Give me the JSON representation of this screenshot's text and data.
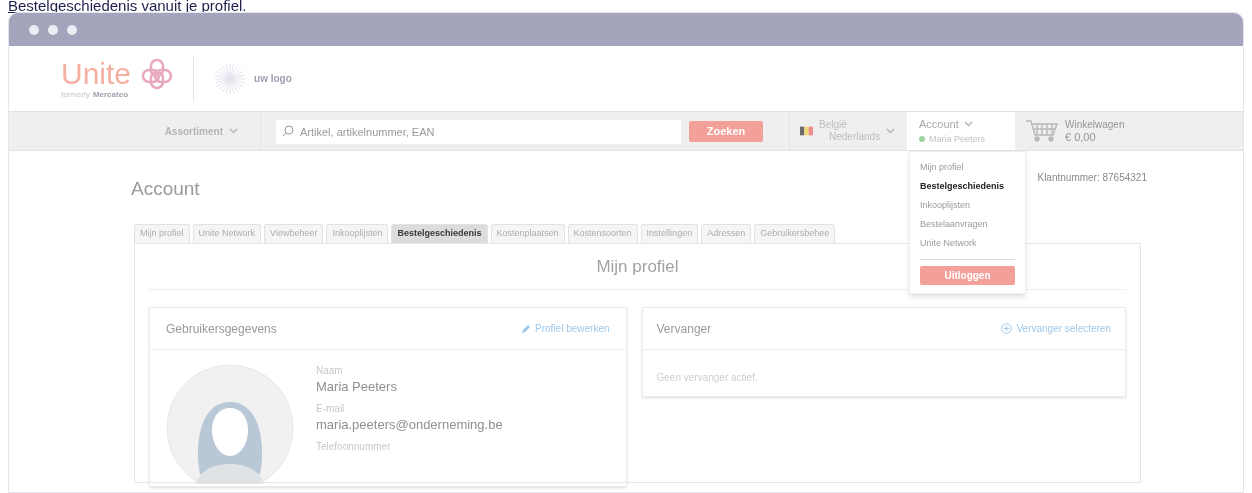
{
  "caption": {
    "link": "Bestelgeschiedenis",
    "text": "vanuit je profiel."
  },
  "header": {
    "brand": "Unite",
    "brand_sub_prefix": "formerly",
    "brand_sub_name": "Mercateo",
    "partner_logo": "uw logo"
  },
  "navbar": {
    "assortment": "Assortiment",
    "search": {
      "placeholder": "Artikel, artikelnummer, EAN"
    },
    "search_button": "Zoeken",
    "region": {
      "country": "België",
      "language": "Nederlands"
    },
    "account": {
      "label": "Account",
      "user": "Maria Peeters",
      "online": true
    },
    "cart": {
      "label": "Winkelwagen",
      "total": "€ 0,00"
    }
  },
  "account_menu": {
    "items": [
      {
        "label": "Mijn profiel",
        "selected": false
      },
      {
        "label": "Bestelgeschiedenis",
        "selected": true
      },
      {
        "label": "Inkooplijsten",
        "selected": false
      },
      {
        "label": "Bestelaanvragen",
        "selected": false
      },
      {
        "label": "Unite Network",
        "selected": false
      }
    ],
    "logout": "Uitloggen"
  },
  "page": {
    "title": "Account",
    "customer_number": "Klantnummer: 87654321"
  },
  "tabs": [
    {
      "label": "Mijn profiel",
      "selected": false
    },
    {
      "label": "Unite Network",
      "selected": false
    },
    {
      "label": "Viewbeheer",
      "selected": false
    },
    {
      "label": "Inkooplijsten",
      "selected": false
    },
    {
      "label": "Bestelgeschiedenis",
      "selected": true
    },
    {
      "label": "Kostenplaatsen",
      "selected": false
    },
    {
      "label": "Kostensoorten",
      "selected": false
    },
    {
      "label": "Instellingen",
      "selected": false
    },
    {
      "label": "Adressen",
      "selected": false
    },
    {
      "label": "Gebruikersbehee",
      "selected": false
    }
  ],
  "panel_title": "Mijn profiel",
  "user_card": {
    "title": "Gebruikersgegevens",
    "action": "Profiel bewerken",
    "fields": [
      {
        "label": "Naam",
        "value": "Maria Peeters"
      },
      {
        "label": "E-mail",
        "value": "maria.peeters@onderneming.be"
      },
      {
        "label": "Telefoonnummer"
      }
    ]
  },
  "substitute_card": {
    "title": "Vervanger",
    "action": "Vervanger selecteren",
    "empty": "Geen vervanger actief."
  }
}
